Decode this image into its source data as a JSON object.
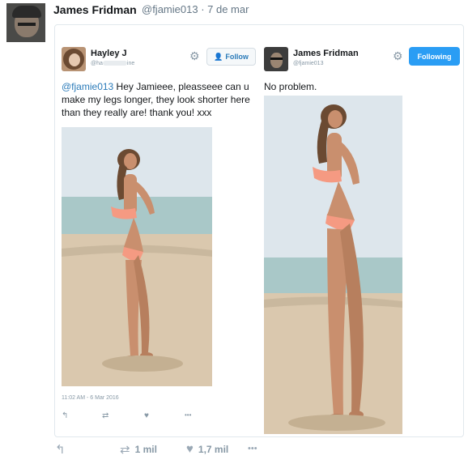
{
  "tweet": {
    "author_name": "James Fridman",
    "author_handle": "@fjamie013",
    "date": "· 7 de mar",
    "avatar_icon": "user-avatar"
  },
  "left_post": {
    "name": "Hayley J",
    "handle_prefix": "@ha",
    "handle_suffix": "ine",
    "follow_label": "Follow",
    "mention": "@fjamie013",
    "text": " Hey Jamieee, pleasseee can u make my legs longer, they look shorter here than they really are! thank you! xxx",
    "timestamp": "11:02 AM - 6 Mar 2016",
    "actions": {
      "reply": "↰",
      "retweet": "⇄",
      "like": "♥",
      "more": "•••"
    }
  },
  "right_post": {
    "name": "James Fridman",
    "handle": "@fjamie013",
    "following_label": "Following",
    "text": "No problem."
  },
  "footer": {
    "reply_icon": "↰",
    "retweet_icon": "⇄",
    "retweet_count": "1 mil",
    "like_icon": "♥",
    "like_count": "1,7 mil",
    "more_icon": "•••"
  },
  "colors": {
    "accent": "#2a9df4",
    "link": "#2b7bb9",
    "muted": "#8899a6"
  }
}
